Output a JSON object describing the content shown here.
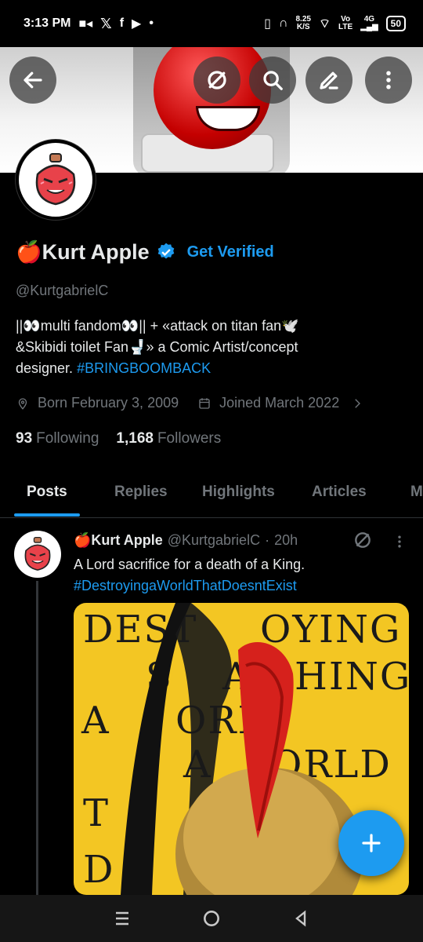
{
  "status_bar": {
    "time": "3:13 PM",
    "speed_value": "8.25",
    "speed_unit": "K/S",
    "network_vo": "Vo",
    "network_lte": "LTE",
    "network_4g": "4G",
    "battery": "50"
  },
  "profile": {
    "display_name": "🍎Kurt Apple",
    "get_verified": "Get Verified",
    "handle": "@KurtgabrielC",
    "bio_line1": "||👀multi fandom👀|| + «attack on titan fan🕊️",
    "bio_line2": "&Skibidi toilet Fan🚽» a Comic Artist/concept",
    "bio_line3_prefix": "designer. ",
    "bio_hashtag": "#BRINGBOOMBACK",
    "born": "Born February 3, 2009",
    "joined": "Joined March 2022",
    "following_count": "93",
    "following_label": "Following",
    "followers_count": "1,168",
    "followers_label": "Followers"
  },
  "tabs": [
    "Posts",
    "Replies",
    "Highlights",
    "Articles",
    "M"
  ],
  "active_tab": "Posts",
  "post": {
    "author": "🍎Kurt Apple",
    "handle": "@KurtgabrielC",
    "separator": "·",
    "time": "20h",
    "text": "A Lord sacrifice for a death of a King.",
    "hashtag": "#DestroyingaWorldThatDoesntExist",
    "media_lines": [
      "DEST",
      "OYING",
      "S",
      "AR",
      "HING",
      "A",
      "ORL",
      "A",
      "ORLD",
      "T",
      "D"
    ]
  },
  "colors": {
    "accent": "#1d9bf0",
    "muted": "#71767b",
    "text": "#e7e9ea",
    "background": "#000000",
    "media_background": "#f3c623"
  },
  "icons": {
    "back": "arrow-left-icon",
    "grok": "grok-icon",
    "search": "search-icon",
    "edit": "pencil-icon",
    "more": "more-vertical-icon",
    "verified": "verified-badge-icon",
    "location": "location-icon",
    "calendar": "calendar-icon",
    "compose": "plus-icon"
  }
}
